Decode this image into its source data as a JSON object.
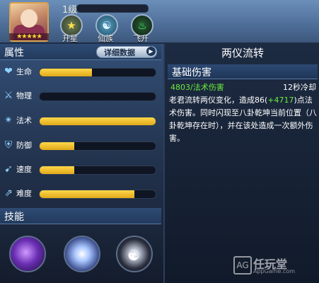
{
  "header": {
    "level": "1级",
    "stars": "★★★★★",
    "buttons": [
      {
        "label": "升星",
        "icon": "star-icon"
      },
      {
        "label": "仙族",
        "icon": "taiji-icon"
      },
      {
        "label": "飞升",
        "icon": "flame-icon"
      }
    ]
  },
  "attributes": {
    "title": "属性",
    "detail_button": "详细数据",
    "stats": [
      {
        "label": "生命",
        "icon": "heart-icon",
        "fraction": 0.45
      },
      {
        "label": "物理",
        "icon": "sword-icon",
        "fraction": 0.0
      },
      {
        "label": "法术",
        "icon": "magic-icon",
        "fraction": 1.0
      },
      {
        "label": "防御",
        "icon": "shield-icon",
        "fraction": 0.3
      },
      {
        "label": "速度",
        "icon": "boot-icon",
        "fraction": 0.3
      },
      {
        "label": "难度",
        "icon": "difficulty-icon",
        "fraction": 0.82
      }
    ]
  },
  "skills": {
    "title": "技能",
    "icons": [
      "skill-1-icon",
      "skill-2-icon",
      "skill-3-icon"
    ]
  },
  "detail": {
    "title": "两仪流转",
    "subheader": "基础伤害",
    "damage": "4803/法术伤害",
    "cooldown": "12秒冷却",
    "desc_part1": "老君流转两仪变化，造成86(",
    "desc_bonus": "+4717",
    "desc_part2": ")点法术伤害。同时闪现至八卦乾坤当前位置（八卦乾坤存在时），并在该处造成一次额外伤害。"
  },
  "watermark": {
    "logo": "AG",
    "name": "任玩堂",
    "url": "AppGame.com"
  },
  "colors": {
    "bar_fill": "#e6b21f",
    "accent_green": "#6bee3c",
    "panel_blue": "#2f4b74"
  }
}
